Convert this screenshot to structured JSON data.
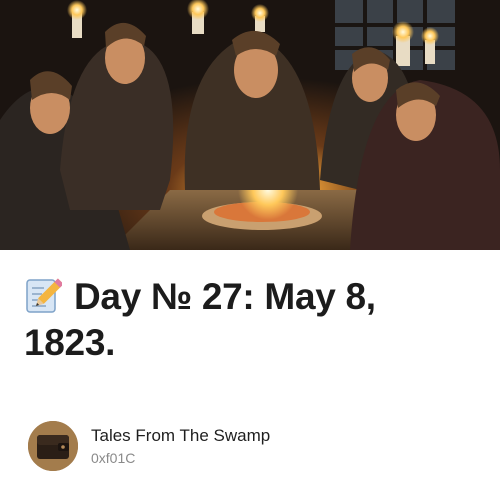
{
  "post": {
    "cover": {
      "alt": "cover-image",
      "icon": "tavern-scene"
    },
    "title_emoji": "memo-icon",
    "title": "Day № 27: May 8, 1823."
  },
  "author": {
    "name": "Tales From The Swamp",
    "handle": "0xf01C",
    "avatar_icon": "wallet-avatar"
  },
  "colors": {
    "title": "#1c1c1c",
    "author": "#1f1f1f",
    "handle": "#8a8a8a"
  }
}
